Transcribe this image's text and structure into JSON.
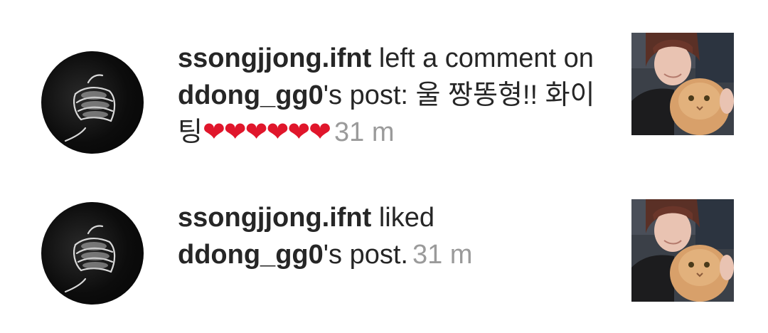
{
  "notifications": [
    {
      "username": "ssongjjong.ifnt",
      "action_text": " left a comment on ",
      "target_user": "ddong_gg0",
      "suffix": "'s post: ",
      "comment": "울 짱똥형!! 화이팅",
      "hearts": "❤❤❤❤❤❤",
      "time": "31 m",
      "avatar_icon": "clasped-hands-avatar",
      "thumbnail_icon": "person-with-cat-photo"
    },
    {
      "username": "ssongjjong.ifnt",
      "action_text": " liked ",
      "target_user": "ddong_gg0",
      "suffix": "'s post.",
      "time": "31 m",
      "avatar_icon": "clasped-hands-avatar",
      "thumbnail_icon": "person-with-cat-photo"
    }
  ],
  "colors": {
    "text": "#262626",
    "timestamp": "#9a9a9a",
    "heart": "#e0162b"
  }
}
